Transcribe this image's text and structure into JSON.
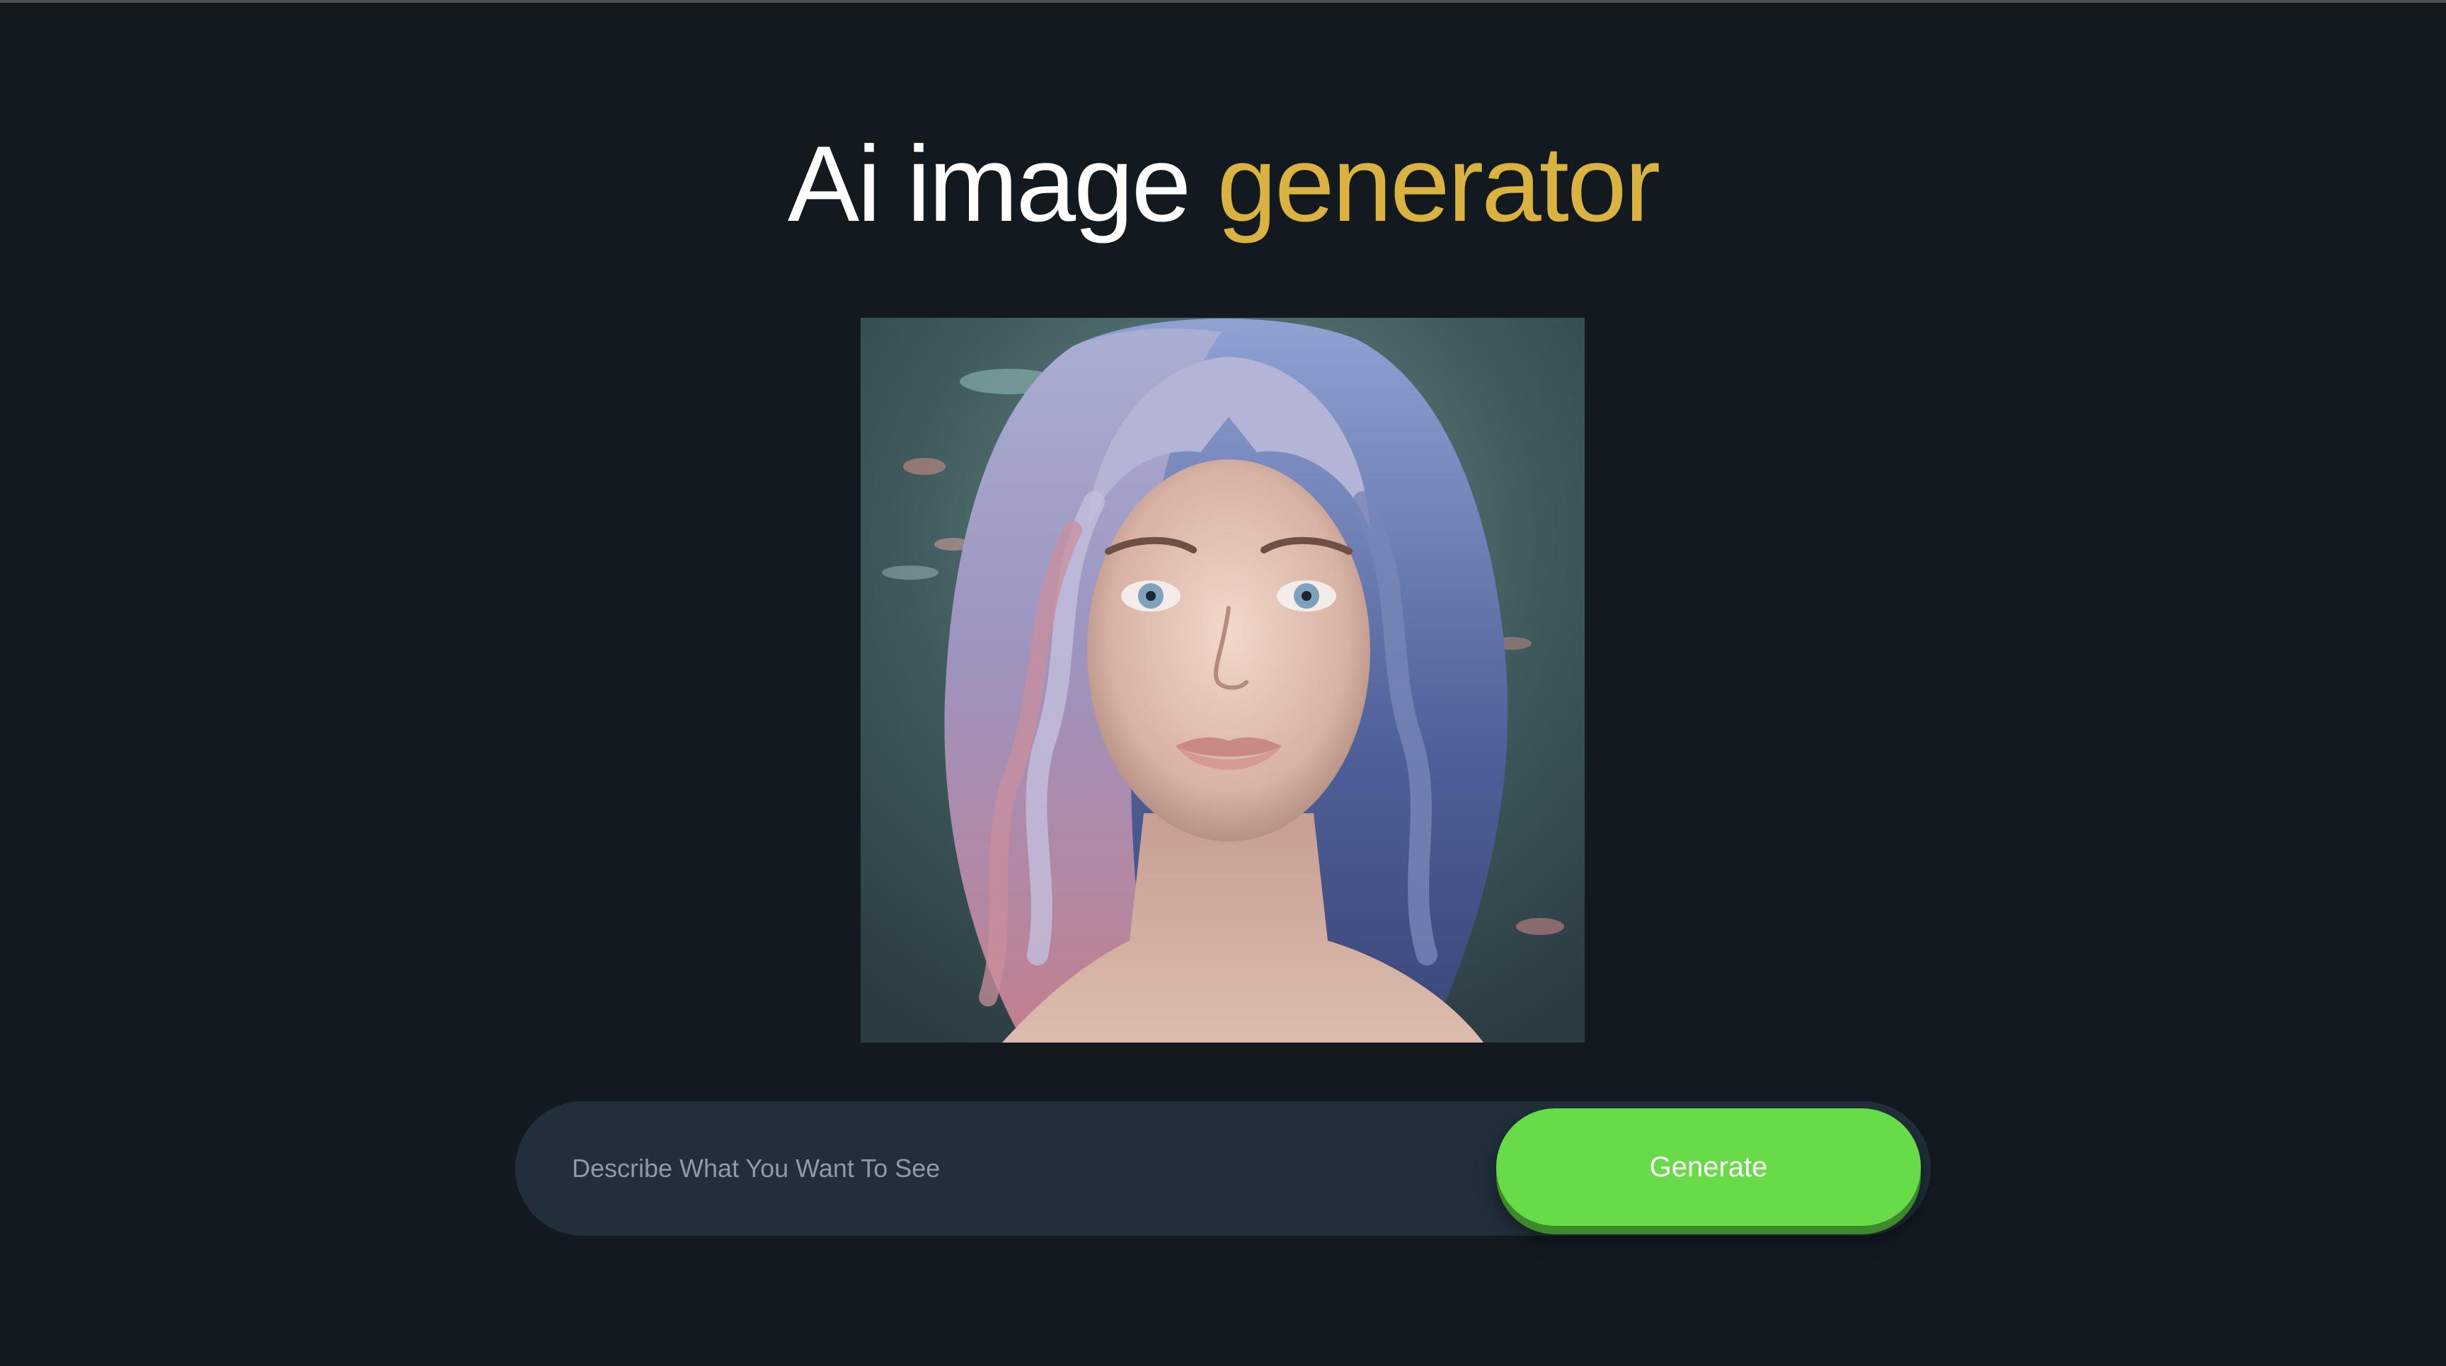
{
  "header": {
    "title_main": "Ai image",
    "title_accent": "generator"
  },
  "preview": {
    "alt": "Generated portrait"
  },
  "prompt": {
    "placeholder": "Describe What You Want To See",
    "value": ""
  },
  "actions": {
    "generate_label": "Generate"
  },
  "colors": {
    "background": "#121a20",
    "accent": "#dab23f",
    "bar": "#202f3a",
    "button": "#68db48"
  }
}
